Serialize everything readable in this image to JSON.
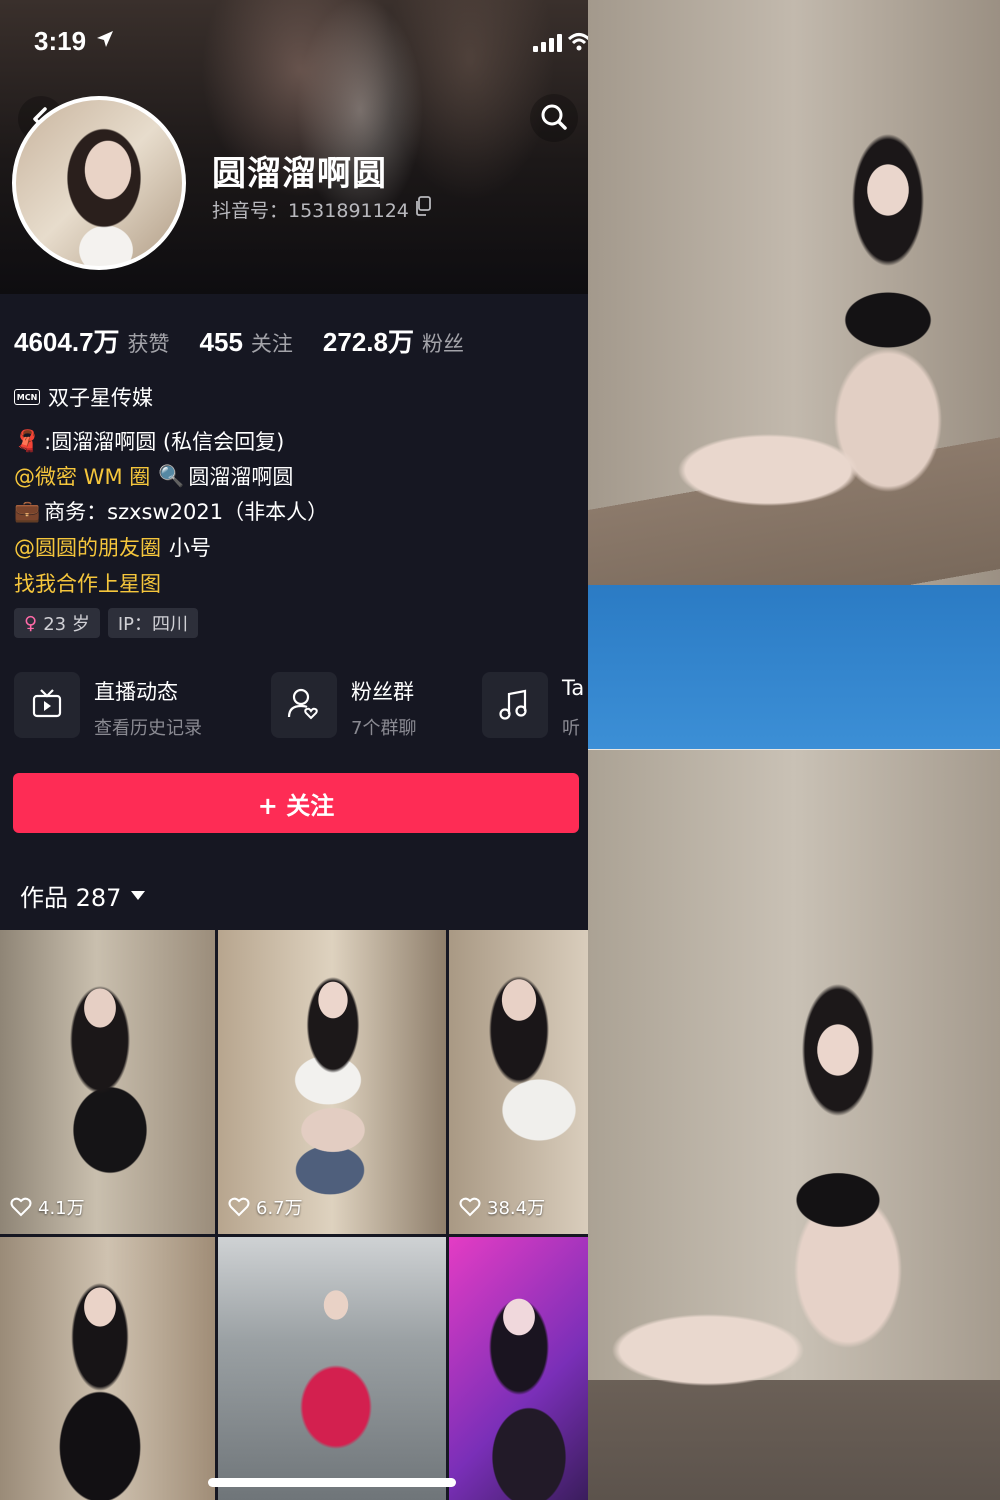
{
  "status_bar": {
    "time": "3:19"
  },
  "profile": {
    "name": "圆溜溜啊圆",
    "douyin_id": "抖音号：1531891124",
    "stats": [
      {
        "value": "4604.7万",
        "label": "获赞"
      },
      {
        "value": "455",
        "label": "关注"
      },
      {
        "value": "272.8万",
        "label": "粉丝"
      }
    ],
    "mcn_badge": "MCN",
    "mcn_name": "双子星传媒",
    "bio": {
      "line1_emoji": "🧣",
      "line1_text": ":圆溜溜啊圆 (私信会回复)",
      "line2_mention": "@微密 WM 圈",
      "line2_emoji": "🔍",
      "line2_text": "圆溜溜啊圆",
      "line3_emoji": "💼",
      "line3_text": "商务：szxsw2021（非本人）",
      "line4_mention": "@圆圆的朋友圈",
      "line4_text": "小号",
      "line5_link": "找我合作上星图"
    },
    "tags": {
      "age": "23 岁",
      "female_symbol": "♀",
      "ip": "IP：四川"
    }
  },
  "shortcuts": [
    {
      "title": "直播动态",
      "subtitle": "查看历史记录",
      "icon": "tv-icon"
    },
    {
      "title": "粉丝群",
      "subtitle": "7个群聊",
      "icon": "fan-group-icon"
    },
    {
      "title": "Ta",
      "subtitle": "听",
      "icon": "music-note-icon"
    }
  ],
  "follow_button": "+ 关注",
  "works_tab": "作品 287",
  "videos": [
    {
      "likes": "4.1万"
    },
    {
      "likes": "6.7万"
    },
    {
      "likes": "38.4万"
    },
    {
      "likes": ""
    },
    {
      "likes": ""
    },
    {
      "likes": ""
    }
  ],
  "colors": {
    "accent": "#fe2c55",
    "mention": "#f5c63c",
    "background": "#161722"
  }
}
